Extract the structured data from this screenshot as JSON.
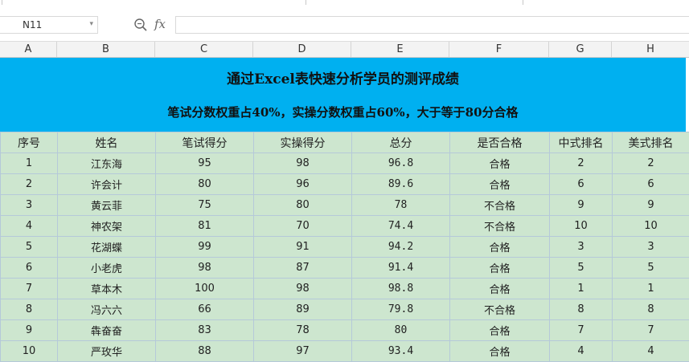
{
  "formula_bar": {
    "cell_ref": "N11",
    "fx_label": "fx",
    "formula": ""
  },
  "columns": [
    "A",
    "B",
    "C",
    "D",
    "E",
    "F",
    "G",
    "H"
  ],
  "banner": {
    "title": "通过Excel表快速分析学员的测评成绩",
    "subtitle": "笔试分数权重占40%，实操分数权重占60%，大于等于80分合格",
    "color": "#00b0f0"
  },
  "table": {
    "headers": [
      "序号",
      "姓名",
      "笔试得分",
      "实操得分",
      "总分",
      "是否合格",
      "中式排名",
      "美式排名"
    ],
    "rows": [
      [
        "1",
        "江东海",
        "95",
        "98",
        "96.8",
        "合格",
        "2",
        "2"
      ],
      [
        "2",
        "许会计",
        "80",
        "96",
        "89.6",
        "合格",
        "6",
        "6"
      ],
      [
        "3",
        "黄云菲",
        "75",
        "80",
        "78",
        "不合格",
        "9",
        "9"
      ],
      [
        "4",
        "神农架",
        "81",
        "70",
        "74.4",
        "不合格",
        "10",
        "10"
      ],
      [
        "5",
        "花湖蝶",
        "99",
        "91",
        "94.2",
        "合格",
        "3",
        "3"
      ],
      [
        "6",
        "小老虎",
        "98",
        "87",
        "91.4",
        "合格",
        "5",
        "5"
      ],
      [
        "7",
        "草本木",
        "100",
        "98",
        "98.8",
        "合格",
        "1",
        "1"
      ],
      [
        "8",
        "冯六六",
        "66",
        "89",
        "79.8",
        "不合格",
        "8",
        "8"
      ],
      [
        "9",
        "犇奋奋",
        "83",
        "78",
        "80",
        "合格",
        "7",
        "7"
      ],
      [
        "10",
        "严玫华",
        "88",
        "97",
        "93.4",
        "合格",
        "4",
        "4"
      ]
    ],
    "fill_color": "#cde6cf"
  }
}
